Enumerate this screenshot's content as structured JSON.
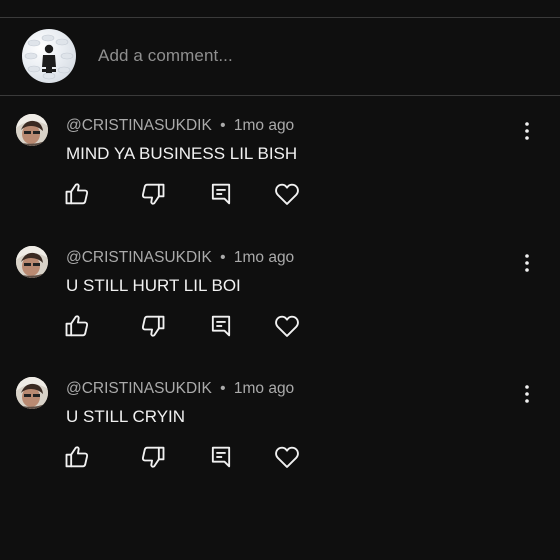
{
  "composer": {
    "placeholder": "Add a comment..."
  },
  "comments": [
    {
      "author": "@CRISTINASUKDIK",
      "separator": "•",
      "time": "1mo ago",
      "text": "MIND YA BUSINESS LIL BISH"
    },
    {
      "author": "@CRISTINASUKDIK",
      "separator": "•",
      "time": "1mo ago",
      "text": "U STILL HURT LIL BOI"
    },
    {
      "author": "@CRISTINASUKDIK",
      "separator": "•",
      "time": "1mo ago",
      "text": "U STILL CRYIN"
    }
  ],
  "icons": {
    "like": "thumbs-up-icon",
    "dislike": "thumbs-down-icon",
    "reply": "reply-icon",
    "heart": "heart-icon",
    "menu": "more-vertical-icon"
  },
  "colors": {
    "background": "#0f0f0f",
    "text_primary": "#f1f1f1",
    "text_secondary": "#aaaaaa",
    "placeholder": "#8f8f8f",
    "divider": "#3a3a3a"
  }
}
